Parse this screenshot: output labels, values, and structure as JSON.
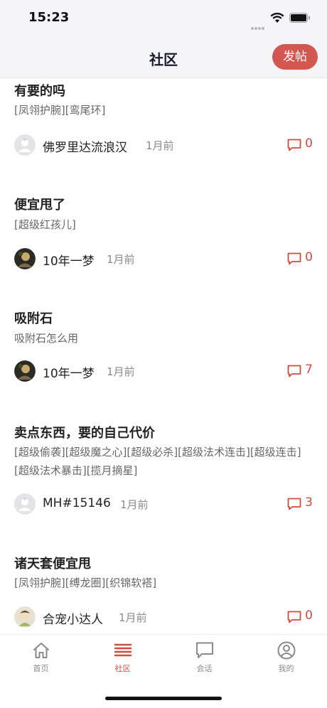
{
  "status_bar": {
    "time": "15:23"
  },
  "header": {
    "title": "社区",
    "post_button_label": "发帖"
  },
  "posts": [
    {
      "title": "有要的吗",
      "tags": "[凤翎护腕][鸾尾环]",
      "author": "佛罗里达流浪汉",
      "time": "1月前",
      "comments": "0",
      "avatar": "default-avatar"
    },
    {
      "title": "便宜甩了",
      "tags": "[超级红孩儿]",
      "author": "10年一梦",
      "time": "1月前",
      "comments": "0",
      "avatar": "photo-avatar"
    },
    {
      "title": "吸附石",
      "tags": "吸附石怎么用",
      "author": "10年一梦",
      "time": "1月前",
      "comments": "7",
      "avatar": "photo-avatar"
    },
    {
      "title": "卖点东西，要的自己代价",
      "tags": "[超级偷袭][超级魔之心][超级必杀][超级法术连击][超级连击][超级法术暴击][揽月摘星]",
      "author": "MH#15146",
      "time": "1月前",
      "comments": "3",
      "avatar": "default-avatar"
    },
    {
      "title": "诸天套便宜甩",
      "tags": "[凤翎护腕][缚龙圈][织锦软褡]",
      "author": "合宠小达人",
      "time": "1月前",
      "comments": "0",
      "avatar": "cartoon-avatar"
    }
  ],
  "tabs": [
    {
      "label": "首页",
      "icon": "home-icon",
      "active": false
    },
    {
      "label": "社区",
      "icon": "list-icon",
      "active": true
    },
    {
      "label": "会话",
      "icon": "chat-icon",
      "active": false
    },
    {
      "label": "我的",
      "icon": "profile-icon",
      "active": false
    }
  ],
  "colors": {
    "accent": "#d14b3f",
    "post_button": "#d45650",
    "header_bg": "#f5f5f7"
  }
}
